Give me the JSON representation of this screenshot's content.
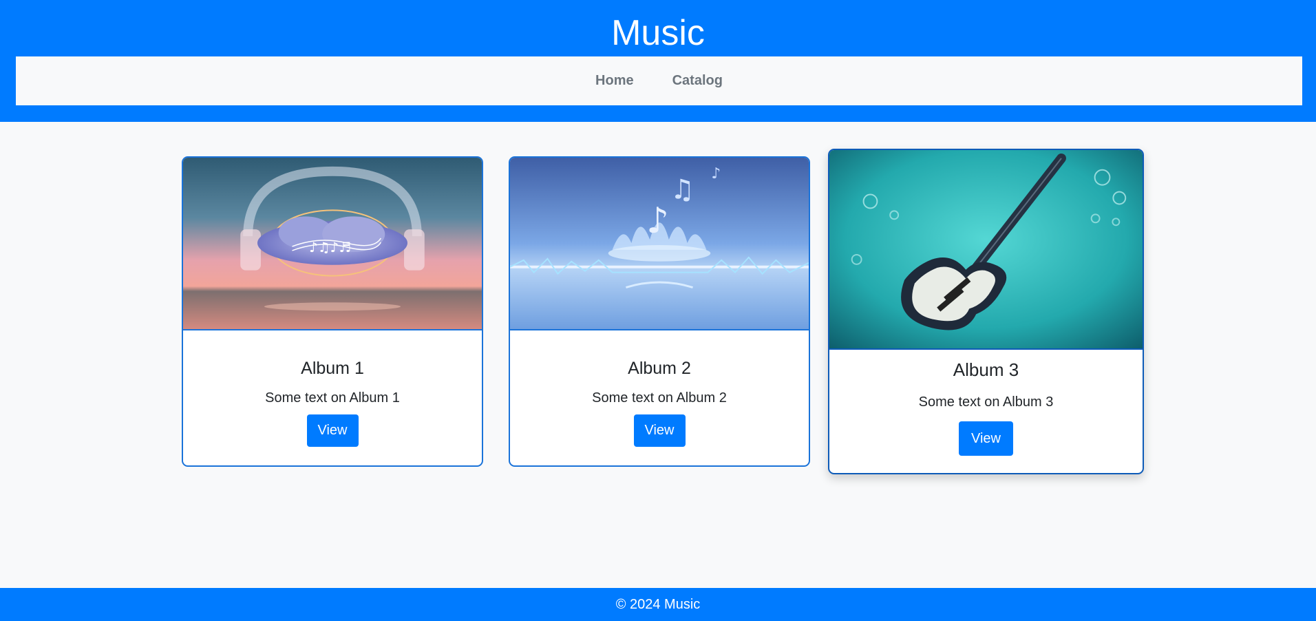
{
  "header": {
    "title": "Music",
    "nav": [
      {
        "label": "Home"
      },
      {
        "label": "Catalog"
      }
    ]
  },
  "albums": [
    {
      "image_icon": "album-art-headphones-cloud",
      "title": "Album 1",
      "text": "Some text on Album 1",
      "button_label": "View"
    },
    {
      "image_icon": "album-art-water-splash-notes",
      "title": "Album 2",
      "text": "Some text on Album 2",
      "button_label": "View"
    },
    {
      "image_icon": "album-art-guitar-underwater",
      "title": "Album 3",
      "text": "Some text on Album 3",
      "button_label": "View"
    }
  ],
  "footer": {
    "text": "© 2024 Music"
  },
  "colors": {
    "brand": "#007bff",
    "background": "#f8f9fa",
    "nav_text": "#6c757d",
    "card_border": "#1a73d9"
  }
}
